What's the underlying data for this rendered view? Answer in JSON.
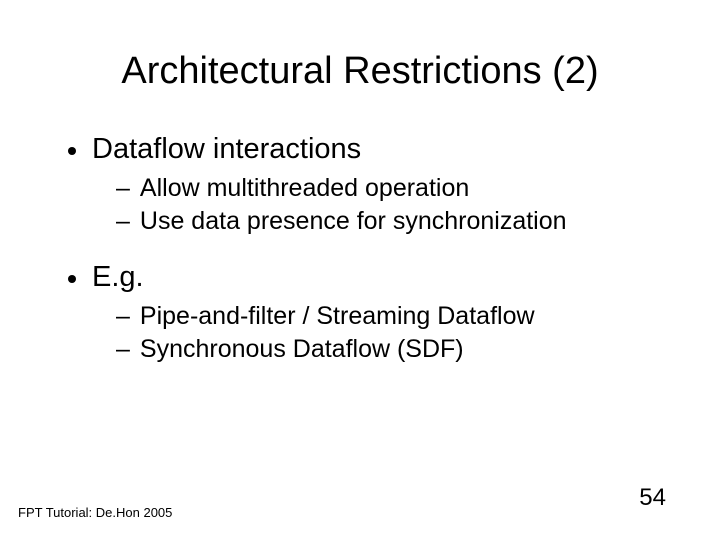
{
  "slide": {
    "title": "Architectural Restrictions (2)",
    "bullets": [
      {
        "text": "Dataflow interactions",
        "sub": [
          "Allow multithreaded operation",
          "Use data presence for synchronization"
        ]
      },
      {
        "text": "E.g.",
        "sub": [
          "Pipe-and-filter / Streaming Dataflow",
          "Synchronous Dataflow (SDF)"
        ]
      }
    ],
    "footer_left": "FPT Tutorial: De.Hon 2005",
    "page_number": "54"
  }
}
